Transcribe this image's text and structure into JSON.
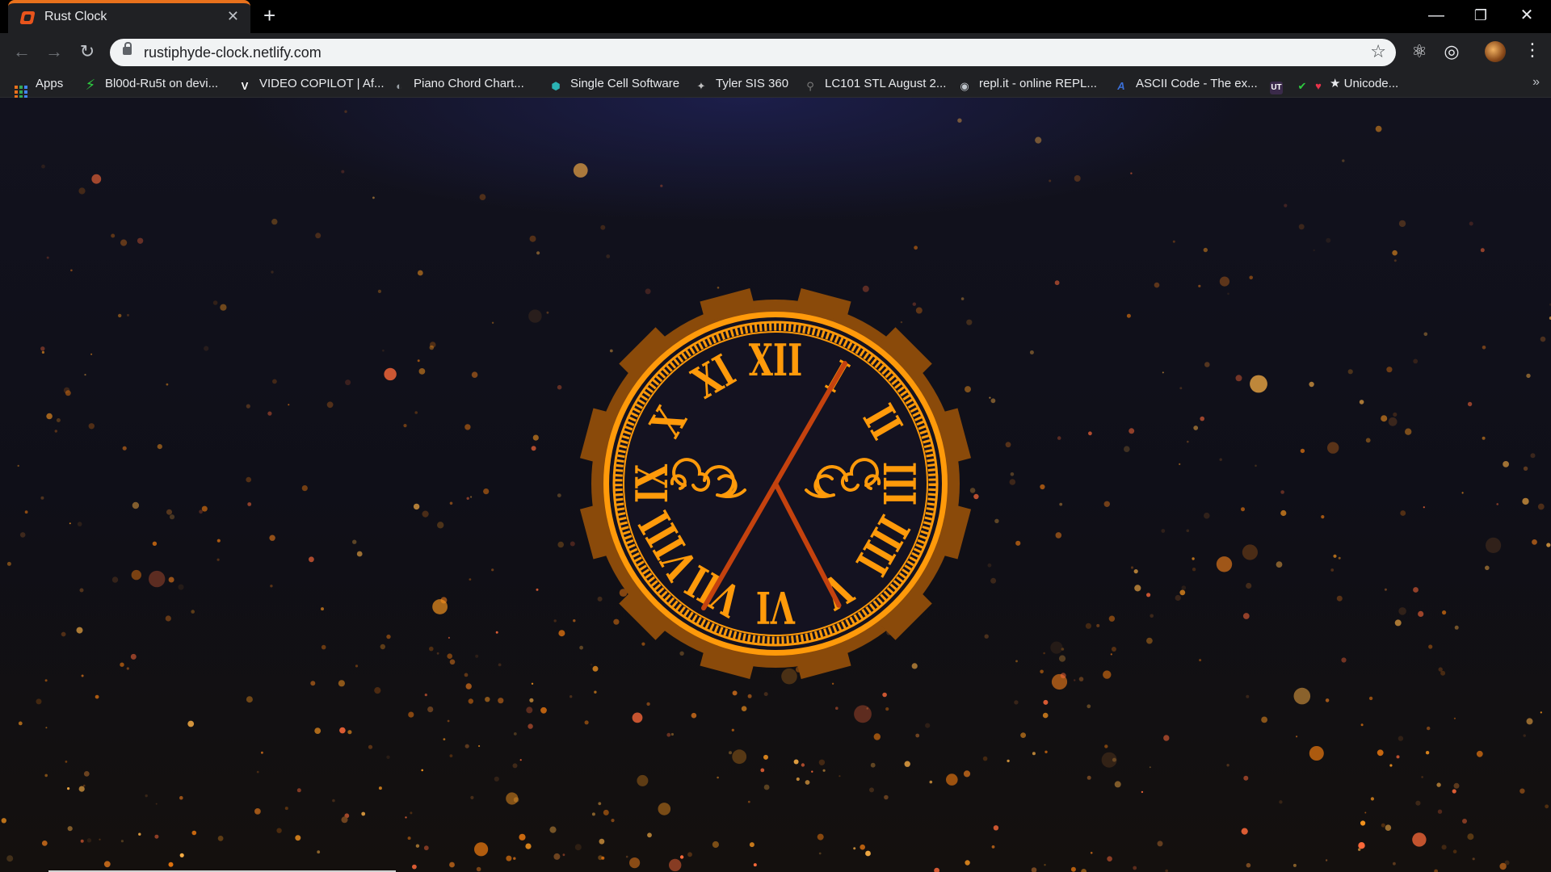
{
  "browser": {
    "tab": {
      "title": "Rust Clock",
      "close_icon": "close-icon"
    },
    "new_tab_icon": "plus-icon",
    "window_controls": {
      "minimize": "—",
      "maximize": "❐",
      "close": "✕"
    },
    "toolbar": {
      "back_icon": "←",
      "forward_icon": "→",
      "reload_icon": "↻",
      "url": "rustiphyde-clock.netlify.com",
      "bookmark_star": "☆",
      "extensions": [
        "⚛",
        "◎"
      ],
      "menu_icon": "⋮"
    },
    "bookmarks": [
      {
        "label": "Apps",
        "icon": "apps-grid-icon"
      },
      {
        "label": "Bl00d-Ru5t on devi...",
        "icon": "dev-icon",
        "glyph": "⚡",
        "color": "#2ecc40"
      },
      {
        "label": "VIDEO COPILOT | Af...",
        "icon": "vc-icon",
        "glyph": "V",
        "color": "#ffffff"
      },
      {
        "label": "Piano Chord Chart...",
        "icon": "globe-icon",
        "glyph": "◐",
        "color": "#9aa0a6"
      },
      {
        "label": "Single Cell Software",
        "icon": "cube-icon",
        "glyph": "⬢",
        "color": "#2bb3b3"
      },
      {
        "label": "Tyler SIS 360",
        "icon": "tyler-icon",
        "glyph": "✦",
        "color": "#c0c0c0"
      },
      {
        "label": "LC101 STL August 2...",
        "icon": "launchcode-icon",
        "glyph": "⚲",
        "color": "#7a7a7a"
      },
      {
        "label": "repl.it - online REPL...",
        "icon": "replit-icon",
        "glyph": "◉",
        "color": "#c0c6cc"
      },
      {
        "label": "ASCII Code - The ex...",
        "icon": "ascii-icon",
        "glyph": "A",
        "color": "#3b6fd6"
      },
      {
        "label": "",
        "icon": "ut-icon",
        "glyph": "UT",
        "color": "#ffffff"
      },
      {
        "label": "★ Unicode...",
        "icon": "unicode-icon",
        "glyph": "✔",
        "glyph2": "♥",
        "color": "#2ecc40",
        "color2": "#e8334a"
      }
    ],
    "more_bookmarks": "»"
  },
  "clock": {
    "numerals": [
      "XII",
      "I",
      "II",
      "III",
      "IIII",
      "V",
      "VI",
      "VII",
      "VIII",
      "IX",
      "X",
      "XI"
    ],
    "time": {
      "hour": 5,
      "minute": 5
    },
    "colors": {
      "gold": "#ff9a0a",
      "rim": "#8a4a0a",
      "hand": "#c4420e",
      "face": "#141220"
    }
  },
  "background": {
    "particle_colors": [
      "#ff9a1f",
      "#e8770f",
      "#ff6a3a",
      "#c86a1a",
      "#ffb347",
      "#7a4a22"
    ]
  }
}
